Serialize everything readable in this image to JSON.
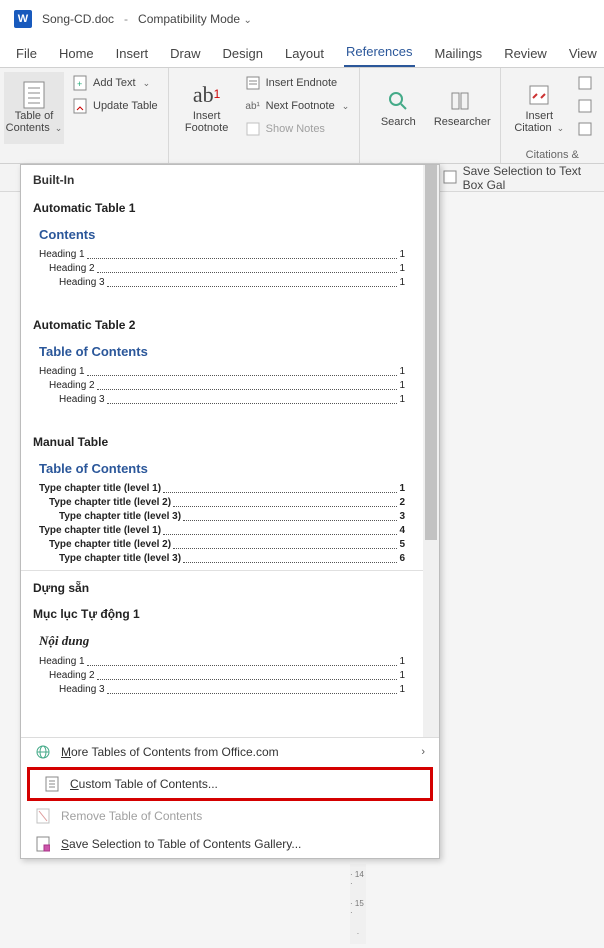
{
  "title": {
    "app_icon": "W",
    "filename": "Song-CD.doc",
    "mode": "Compatibility Mode"
  },
  "menubar": {
    "items": [
      "File",
      "Home",
      "Insert",
      "Draw",
      "Design",
      "Layout",
      "References",
      "Mailings",
      "Review",
      "View"
    ],
    "active": 6
  },
  "ribbon": {
    "toc": {
      "label": "Table of\nContents",
      "add_text": "Add Text",
      "update": "Update Table"
    },
    "footnotes": {
      "insert": "Insert\nFootnote",
      "endnote": "Insert Endnote",
      "next": "Next Footnote",
      "show": "Show Notes"
    },
    "research": {
      "search": "Search",
      "researcher": "Researcher"
    },
    "citations": {
      "insert": "Insert\nCitation",
      "group": "Citations &"
    }
  },
  "extra": {
    "search": "earch",
    "save_sel": "Save Selection to Text Box Gal"
  },
  "dropdown": {
    "builtin": "Built-In",
    "auto1": {
      "hd": "Automatic Table 1",
      "title": "Contents",
      "rows": [
        [
          "Heading 1",
          "1",
          0
        ],
        [
          "Heading 2",
          "1",
          1
        ],
        [
          "Heading 3",
          "1",
          2
        ]
      ]
    },
    "auto2": {
      "hd": "Automatic Table 2",
      "title": "Table of Contents",
      "rows": [
        [
          "Heading 1",
          "1",
          0
        ],
        [
          "Heading 2",
          "1",
          1
        ],
        [
          "Heading 3",
          "1",
          2
        ]
      ]
    },
    "manual": {
      "hd": "Manual Table",
      "title": "Table of Contents",
      "rows": [
        [
          "Type chapter title (level 1)",
          "1",
          0
        ],
        [
          "Type chapter title (level 2)",
          "2",
          1
        ],
        [
          "Type chapter title (level 3)",
          "3",
          2
        ],
        [
          "Type chapter title (level 1)",
          "4",
          0
        ],
        [
          "Type chapter title (level 2)",
          "5",
          1
        ],
        [
          "Type chapter title (level 3)",
          "6",
          2
        ]
      ]
    },
    "dungsan": {
      "hd1": "Dựng sẵn",
      "hd2": "Mục lục Tự động 1",
      "title": "Nội dung",
      "rows": [
        [
          "Heading 1",
          "1",
          0
        ],
        [
          "Heading 2",
          "1",
          1
        ],
        [
          "Heading 3",
          "1",
          2
        ]
      ]
    },
    "more": "More Tables of Contents from Office.com",
    "custom": "Custom Table of Contents...",
    "remove": "Remove Table of Contents",
    "savegal": "Save Selection to Table of Contents Gallery..."
  },
  "ruler": [
    "· 14 ·",
    "· 15 ·",
    "·"
  ]
}
